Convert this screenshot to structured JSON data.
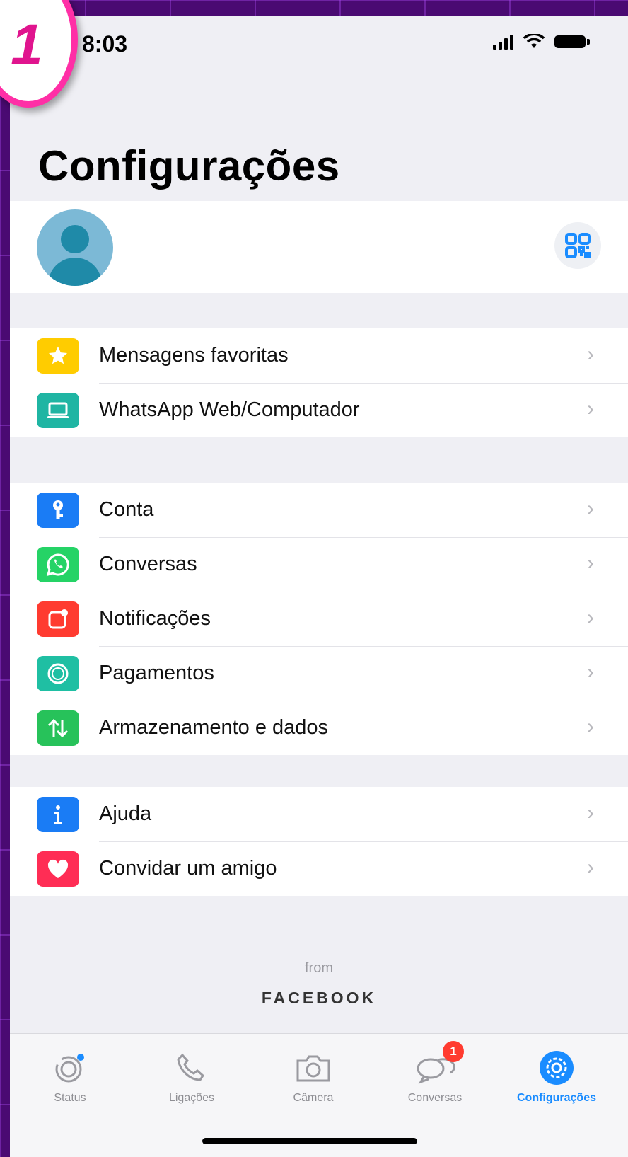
{
  "step_badge": {
    "number": "1"
  },
  "status_bar": {
    "time": "8:03"
  },
  "header": {
    "title": "Configurações"
  },
  "group_a": {
    "items": [
      {
        "label": "Mensagens favoritas",
        "icon": "star-icon",
        "color": "#ffcc00"
      },
      {
        "label": "WhatsApp Web/Computador",
        "icon": "laptop-icon",
        "color": "#1fb5a3"
      }
    ]
  },
  "group_b": {
    "items": [
      {
        "label": "Conta",
        "icon": "key-icon",
        "color": "#1a7cf5"
      },
      {
        "label": "Conversas",
        "icon": "whatsapp-icon",
        "color": "#25d366"
      },
      {
        "label": "Notificações",
        "icon": "notification-icon",
        "color": "#ff3b30"
      },
      {
        "label": "Pagamentos",
        "icon": "payment-icon",
        "color": "#1fbfa3"
      },
      {
        "label": "Armazenamento e dados",
        "icon": "storage-arrows-icon",
        "color": "#27c25a"
      }
    ]
  },
  "group_c": {
    "items": [
      {
        "label": "Ajuda",
        "icon": "info-icon",
        "color": "#1a7cf5"
      },
      {
        "label": "Convidar um amigo",
        "icon": "heart-icon",
        "color": "#ff2d55"
      }
    ]
  },
  "footer": {
    "from": "from",
    "brand": "FACEBOOK"
  },
  "tabbar": {
    "tabs": [
      {
        "label": "Status",
        "icon": "status-icon",
        "active": false
      },
      {
        "label": "Ligações",
        "icon": "phone-icon",
        "active": false
      },
      {
        "label": "Câmera",
        "icon": "camera-icon",
        "active": false
      },
      {
        "label": "Conversas",
        "icon": "chats-icon",
        "active": false,
        "badge": "1"
      },
      {
        "label": "Configurações",
        "icon": "settings-icon",
        "active": true
      }
    ]
  },
  "colors": {
    "accent": "#1a8cff",
    "badge": "#ff3b30",
    "annotation": "#ff2fa6"
  }
}
